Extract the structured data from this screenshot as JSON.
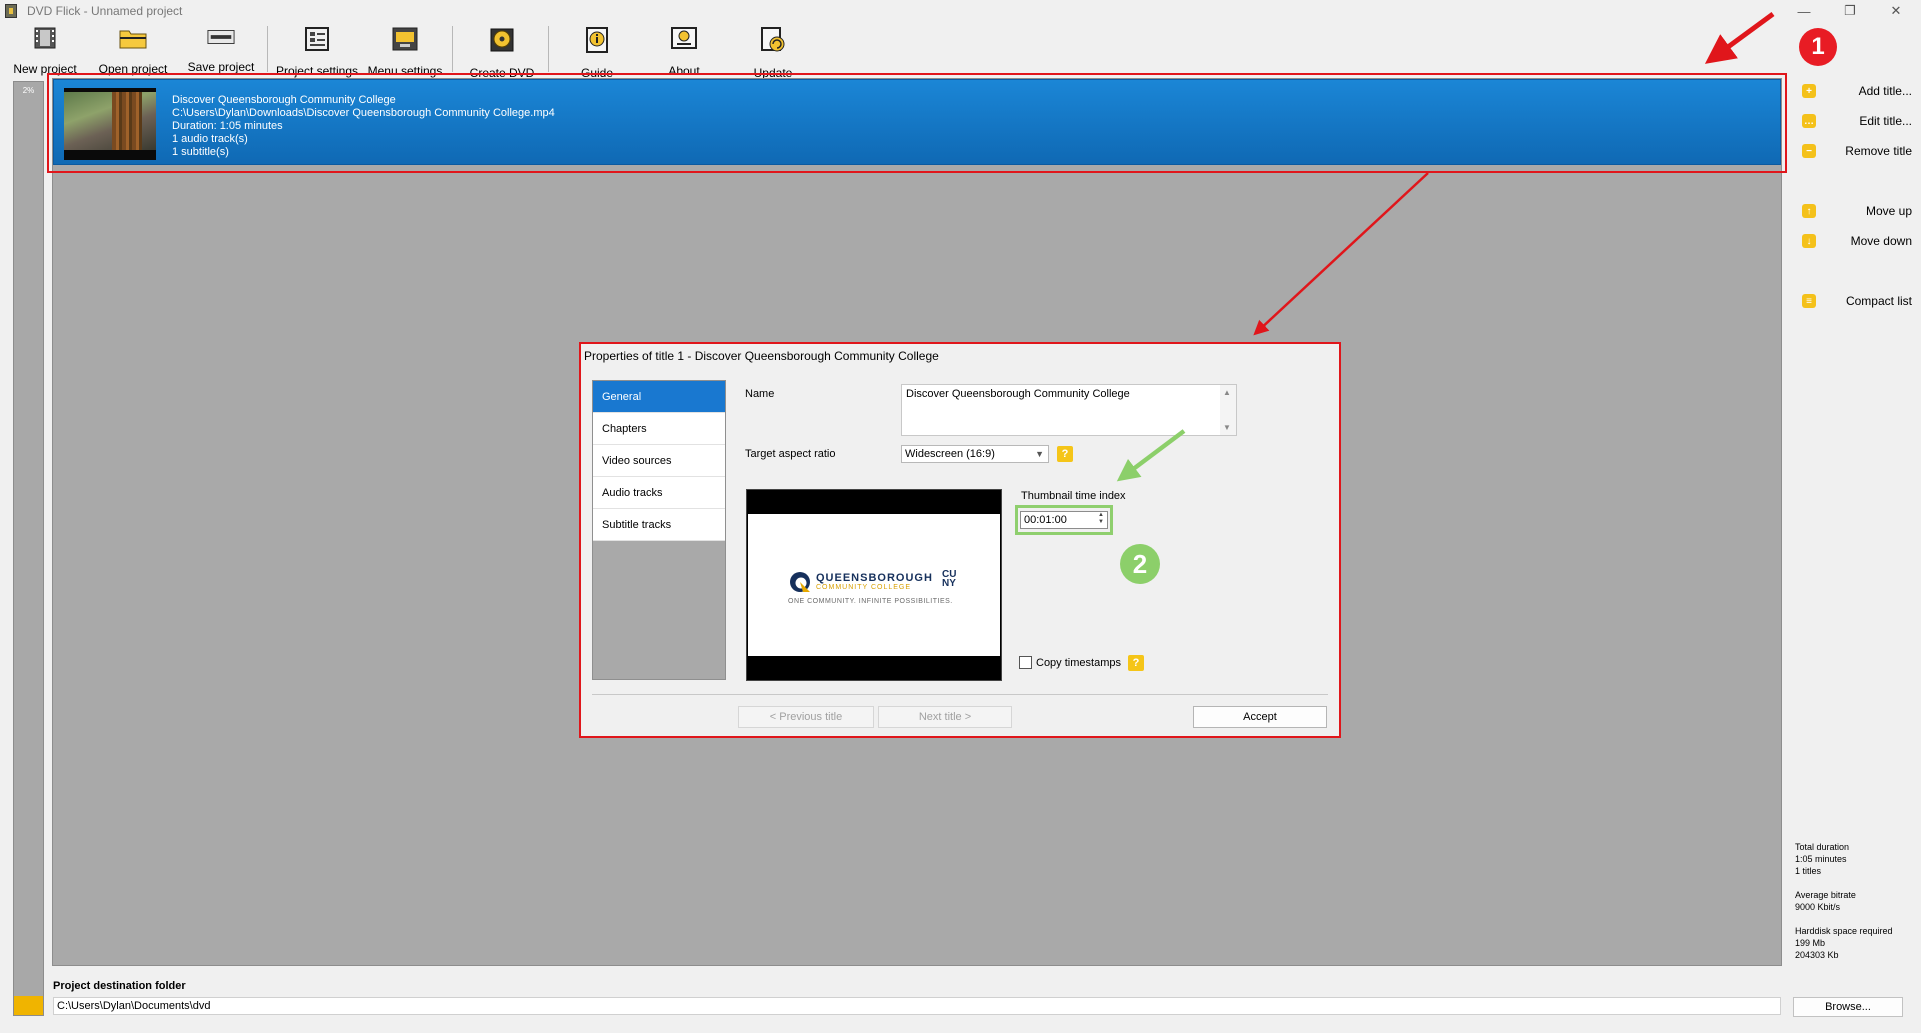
{
  "window": {
    "title": "DVD Flick - Unnamed project",
    "controls": [
      "—",
      "❐",
      "✕"
    ]
  },
  "toolbar": [
    {
      "id": "new-project",
      "label": "New project",
      "icon": "film-icon"
    },
    {
      "id": "open-project",
      "label": "Open project",
      "icon": "folder-icon"
    },
    {
      "id": "save-project",
      "label": "Save project",
      "icon": "drive-icon"
    },
    {
      "id": "project-settings",
      "label": "Project settings",
      "icon": "settings-icon"
    },
    {
      "id": "menu-settings",
      "label": "Menu settings",
      "icon": "menu-icon"
    },
    {
      "id": "create-dvd",
      "label": "Create DVD",
      "icon": "disc-icon"
    },
    {
      "id": "guide",
      "label": "Guide",
      "icon": "guide-icon"
    },
    {
      "id": "about",
      "label": "About",
      "icon": "about-icon"
    },
    {
      "id": "update",
      "label": "Update",
      "icon": "update-icon"
    }
  ],
  "progress": {
    "label": "2%",
    "value": 0.02
  },
  "title_item": {
    "name": "Discover Queensborough Community College",
    "path": "C:\\Users\\Dylan\\Downloads\\Discover Queensborough Community College.mp4",
    "duration": "Duration: 1:05 minutes",
    "audio": "1 audio track(s)",
    "subtitles": "1 subtitle(s)"
  },
  "sidebar": [
    {
      "id": "add-title",
      "label": "Add title...",
      "glyph": "+"
    },
    {
      "id": "edit-title",
      "label": "Edit title...",
      "glyph": "…"
    },
    {
      "id": "remove-title",
      "label": "Remove title",
      "glyph": "−"
    },
    {
      "id": "move-up",
      "label": "Move up",
      "glyph": "↑"
    },
    {
      "id": "move-down",
      "label": "Move down",
      "glyph": "↓"
    },
    {
      "id": "compact-list",
      "label": "Compact list",
      "glyph": "≡"
    }
  ],
  "stats": {
    "duration_label": "Total duration",
    "duration_value": "1:05 minutes",
    "titles": "1 titles",
    "bitrate_label": "Average bitrate",
    "bitrate_value": "9000 Kbit/s",
    "space_label": "Harddisk space required",
    "space_mb": "199 Mb",
    "space_kb": "204303 Kb"
  },
  "destination": {
    "label": "Project destination folder",
    "value": "C:\\Users\\Dylan\\Documents\\dvd",
    "browse": "Browse..."
  },
  "dialog": {
    "title": "Properties of title 1 - Discover Queensborough Community College",
    "tabs": [
      "General",
      "Chapters",
      "Video sources",
      "Audio tracks",
      "Subtitle tracks"
    ],
    "active_tab": 0,
    "name_label": "Name",
    "name_value": "Discover Queensborough Community College",
    "aspect_label": "Target aspect ratio",
    "aspect_value": "Widescreen (16:9)",
    "help_glyph": "?",
    "thumb_index_label": "Thumbnail time index",
    "thumb_index_value": "00:01:00",
    "copy_timestamps_label": "Copy timestamps",
    "copy_timestamps_checked": false,
    "prev_button": "< Previous title",
    "next_button": "Next title >",
    "accept_button": "Accept",
    "preview": {
      "wordmark": "QUEENSBOROUGH",
      "subline": "COMMUNITY COLLEGE",
      "tagline": "ONE COMMUNITY. INFINITE POSSIBILITIES.",
      "cuny_top": "CU",
      "cuny_bottom": "NY"
    }
  },
  "annotations": {
    "badge_1": "1",
    "badge_2": "2",
    "red": "#e0161b",
    "green": "#8ccf6a"
  },
  "colors": {
    "selection": "#1978d0",
    "list_bg": "#a9a9a9",
    "accent_yellow": "#f4c11a"
  }
}
